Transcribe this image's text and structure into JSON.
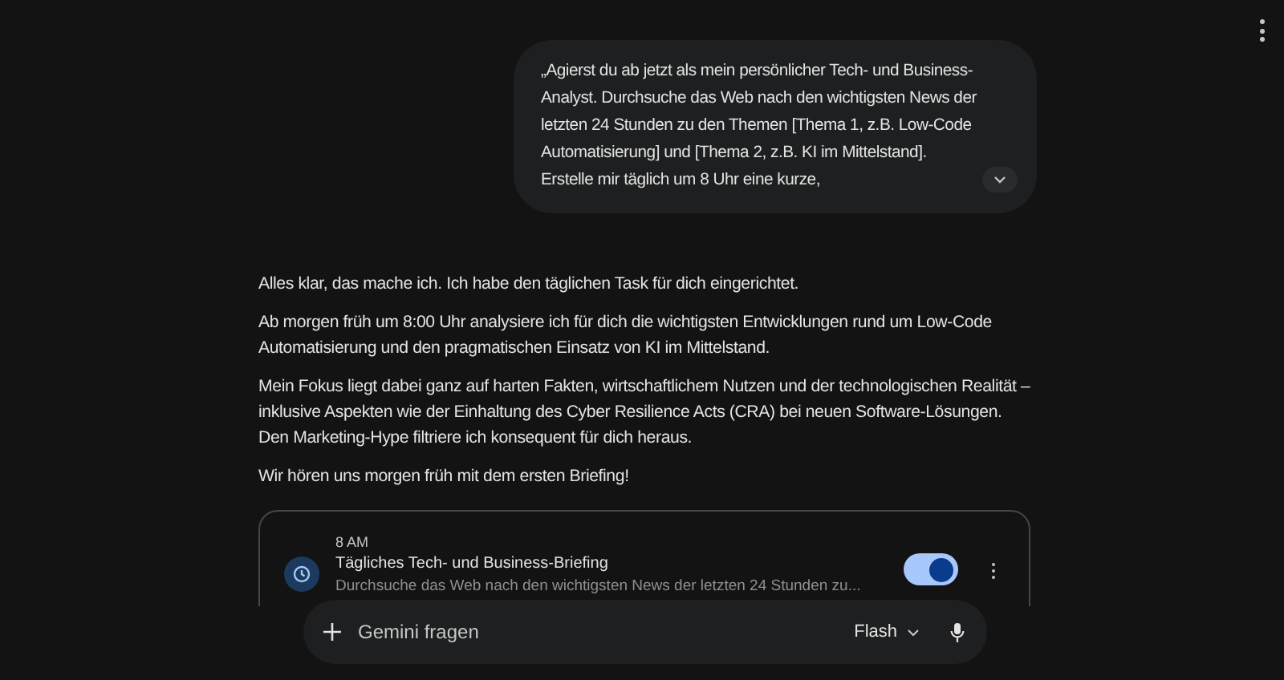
{
  "user_message": {
    "text": "„Agierst du ab jetzt als mein persönlicher Tech- und Business-Analyst. Durchsuche das Web nach den wichtigsten News der letzten 24 Stunden zu den Themen [Thema 1, z.B. Low-Code Automatisierung] und [Thema 2, z.B. KI im Mittelstand]. Erstelle mir täglich um 8 Uhr eine kurze,",
    "expanded": false
  },
  "response": {
    "paragraphs": [
      "Alles klar, das mache ich. Ich habe den täglichen Task für dich eingerichtet.",
      "Ab morgen früh um 8:00 Uhr analysiere ich für dich die wichtigsten Entwicklungen rund um Low-Code Automatisierung und den pragmatischen Einsatz von KI im Mittelstand.",
      "Mein Fokus liegt dabei ganz auf harten Fakten, wirtschaftlichem Nutzen und der technologischen Realität – inklusive Aspekten wie der Einhaltung des Cyber Resilience Acts (CRA) bei neuen Software-Lösungen. Den Marketing-Hype filtriere ich konsequent für dich heraus.",
      "Wir hören uns morgen früh mit dem ersten Briefing!"
    ]
  },
  "scheduled_task": {
    "time": "8 AM",
    "title": "Tägliches Tech- und Business-Briefing",
    "description": "Durchsuche das Web nach den wichtigsten News der letzten 24 Stunden zu...",
    "on": true
  },
  "input": {
    "placeholder": "Gemini fragen",
    "model": "Flash"
  }
}
